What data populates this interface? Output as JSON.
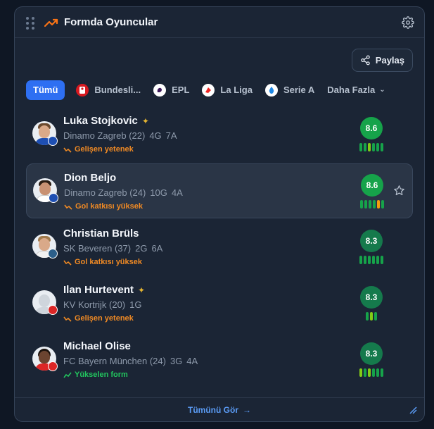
{
  "header": {
    "title": "Formda Oyuncular"
  },
  "toolbar": {
    "share_label": "Paylaş"
  },
  "tabs": [
    {
      "label": "Tümü",
      "active": true
    },
    {
      "label": "Bundesli...",
      "icon": "bundesliga-logo"
    },
    {
      "label": "EPL",
      "icon": "premier-league-logo"
    },
    {
      "label": "La Liga",
      "icon": "laliga-logo"
    },
    {
      "label": "Serie A",
      "icon": "serie-a-logo"
    },
    {
      "label": "Daha Fazla",
      "icon": "chevron-down-icon"
    }
  ],
  "players": [
    {
      "name": "Luka Stojkovic",
      "club": "Dinamo Zagreb (22)",
      "goals": "4G",
      "assists": "7A",
      "tag": "Gelişen yetenek",
      "tag_color": "#f08a24",
      "rating": "8.6",
      "badge": "sparkle-icon",
      "form": [
        "#16a34a",
        "#16a34a",
        "#84cc16",
        "#16a34a",
        "#16a34a",
        "#16a34a"
      ]
    },
    {
      "name": "Dion Beljo",
      "club": "Dinamo Zagreb (24)",
      "goals": "10G",
      "assists": "4A",
      "tag": "Gol katkısı yüksek",
      "tag_color": "#f08a24",
      "rating": "8.6",
      "form": [
        "#16a34a",
        "#16a34a",
        "#16a34a",
        "#16a34a",
        "#f59e0b",
        "#16a34a"
      ]
    },
    {
      "name": "Christian Brüls",
      "club": "SK Beveren (37)",
      "goals": "2G",
      "assists": "6A",
      "tag": "Gol katkısı yüksek",
      "tag_color": "#f08a24",
      "rating": "8.3",
      "form": [
        "#16a34a",
        "#16a34a",
        "#16a34a",
        "#16a34a",
        "#16a34a",
        "#16a34a"
      ]
    },
    {
      "name": "Ilan Hurtevent",
      "club": "KV Kortrijk (20)",
      "goals": "1G",
      "assists": "",
      "tag": "Gelişen yetenek",
      "tag_color": "#f08a24",
      "rating": "8.3",
      "badge": "sparkle-icon",
      "form": [
        "#16a34a",
        "#84cc16",
        "#16a34a"
      ]
    },
    {
      "name": "Michael Olise",
      "club": "FC Bayern München (24)",
      "goals": "3G",
      "assists": "4A",
      "tag": "Yükselen form",
      "tag_color": "#22c55e",
      "rating": "8.3",
      "form": [
        "#84cc16",
        "#16a34a",
        "#84cc16",
        "#16a34a",
        "#16a34a",
        "#16a34a"
      ]
    }
  ],
  "footer": {
    "see_all_label": "Tümünü Gör"
  },
  "colors": {
    "accent": "#2e6ff2",
    "rating_high": "#16a34a",
    "rating_mid": "#157a4c",
    "trend_icon": "#f97316"
  }
}
